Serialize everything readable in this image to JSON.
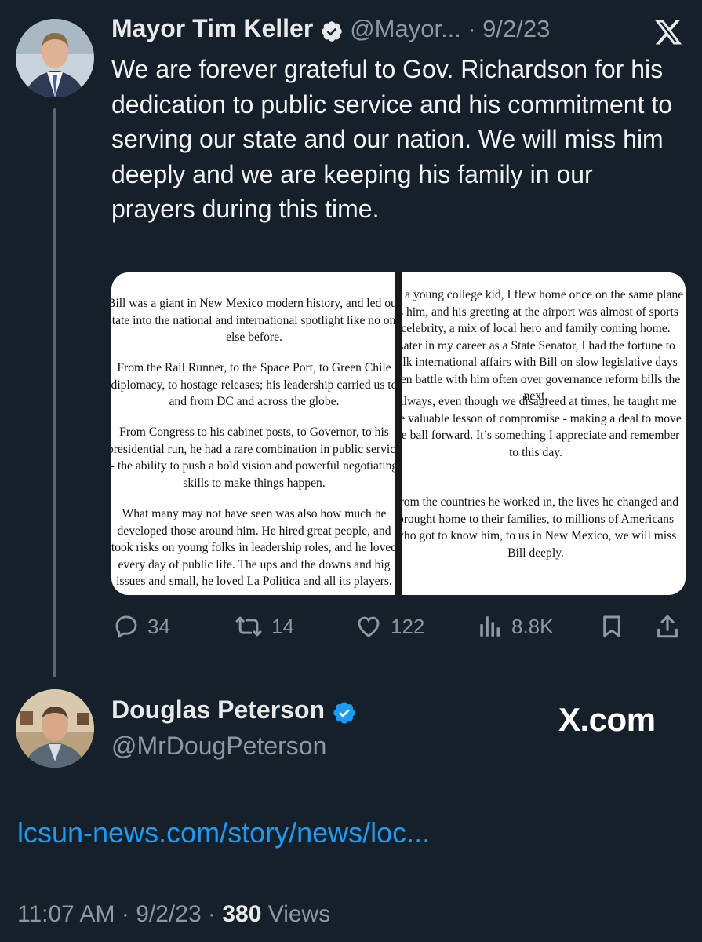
{
  "tweet": {
    "author_name": "Mayor Tim Keller",
    "handle": "@Mayor...",
    "separator": "·",
    "date": "9/2/23",
    "text": "We are forever grateful to Gov. Richardson for his dedication to public service and his commitment to serving our state and our nation. We will miss him deeply and we are keeping his family in our prayers during this time.",
    "media": {
      "left_paragraphs": [
        "Bill was a giant in New Mexico modern history, and led our state into the national and international spotlight like no one else before.",
        "From the Rail Runner, to the Space Port, to Green Chile diplomacy, to hostage releases; his leadership carried us to and from DC and across the globe.",
        "From Congress to his cabinet posts, to Governor, to his presidential run, he had a rare combination in public service - the ability to push a bold vision and powerful negotiating skills to make things happen.",
        "What many may not have seen was also how much he developed those around him. He hired great people, and took risks on young folks in leadership roles, and he loved every day of public life. The ups and the downs and big issues and small, he loved La Politica and all its players."
      ],
      "right_paragraphs": [
        "As a young college kid, I flew home once on the same plane as him, and his greeting at the airport was almost of sports celebrity, a mix of local hero and family coming home. Later in my career as a State Senator, I had the fortune to talk international affairs with Bill on slow legislative days then battle with him often over governance reform bills the next.",
        "Always, even though we disagreed at times, he taught me the valuable lesson of compromise - making a deal to move the ball forward. It’s something I appreciate and remember to this day.",
        "From the countries he worked in, the lives he changed and brought home to their families, to millions of Americans who got to know him, to us in New Mexico, we will miss Bill deeply."
      ]
    },
    "actions": {
      "replies": "34",
      "reposts": "14",
      "likes": "122",
      "views": "8.8K"
    }
  },
  "reply": {
    "author_name": "Douglas Peterson",
    "handle": "@MrDougPeterson",
    "watermark": "X.com",
    "link": "lcsun-news.com/story/news/loc...",
    "time": "11:07 AM",
    "separator": "·",
    "date": "9/2/23",
    "views_count": "380",
    "views_label": "Views"
  },
  "colors": {
    "background": "#15202b",
    "link": "#1d9bf0",
    "verified": "#1d9bf0",
    "muted": "#8b98a5"
  }
}
